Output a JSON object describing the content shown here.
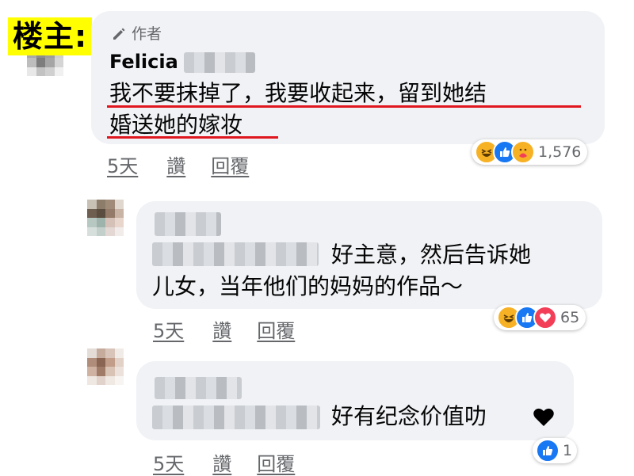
{
  "op_label": "楼主:",
  "comments": [
    {
      "author_tag": "作者",
      "author_name": "Felicia",
      "text_line1": "我不要抹掉了，我要收起来，留到她结",
      "text_line2": "婚送她的嫁妆",
      "time": "5天",
      "like_label": "讚",
      "reply_label": "回覆",
      "reaction_icons": [
        "haha-icon",
        "like-icon",
        "care-icon"
      ],
      "reaction_count": "1,576"
    },
    {
      "text_line1": "好主意，然后告诉她",
      "text_line2": "儿女，当年他们的妈妈的作品～",
      "time": "5天",
      "like_label": "讚",
      "reply_label": "回覆",
      "reaction_icons": [
        "haha-icon",
        "like-icon",
        "love-icon"
      ],
      "reaction_count": "65"
    },
    {
      "text_line1": "好有纪念价值叻",
      "time": "5天",
      "like_label": "讚",
      "reply_label": "回覆",
      "reaction_icons": [
        "like-icon"
      ],
      "reaction_count": "1"
    }
  ],
  "colors": {
    "bubble": "#f0f2f5",
    "underline": "#e0161e",
    "meta": "#65676b",
    "highlight": "#ffff00"
  }
}
